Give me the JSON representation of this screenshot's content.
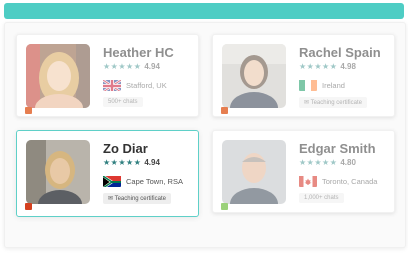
{
  "colors": {
    "accent": "#4ecdc4",
    "active_border": "#5fd0c8",
    "star": "#2f7f7f",
    "status_orange": "#e67e50",
    "status_red": "#d4401f",
    "status_green": "#9bd17a"
  },
  "tutors": [
    {
      "name": "Heather HC",
      "stars": "★★★★★",
      "rating": "4.94",
      "flag_icon": "uk-flag-icon",
      "location": "Stafford, UK",
      "tag": "500+ chats",
      "status_color": "#e67e50"
    },
    {
      "name": "Rachel Spain",
      "stars": "★★★★★",
      "rating": "4.98",
      "flag_icon": "ireland-flag-icon",
      "location": "Ireland",
      "tag_icon": "chat-bubble-icon",
      "tag": "Teaching certificate",
      "status_color": "#e67e50"
    },
    {
      "name": "Zo Diar",
      "stars": "★★★★★",
      "rating": "4.94",
      "flag_icon": "south-africa-flag-icon",
      "location": "Cape Town, RSA",
      "tag_icon": "chat-bubble-icon",
      "tag": "Teaching certificate",
      "status_color": "#d4401f"
    },
    {
      "name": "Edgar Smith",
      "stars": "★★★★★",
      "rating": "4.80",
      "flag_icon": "canada-flag-icon",
      "location": "Toronto, Canada",
      "tag": "1,000+ chats",
      "status_color": "#9bd17a"
    }
  ]
}
